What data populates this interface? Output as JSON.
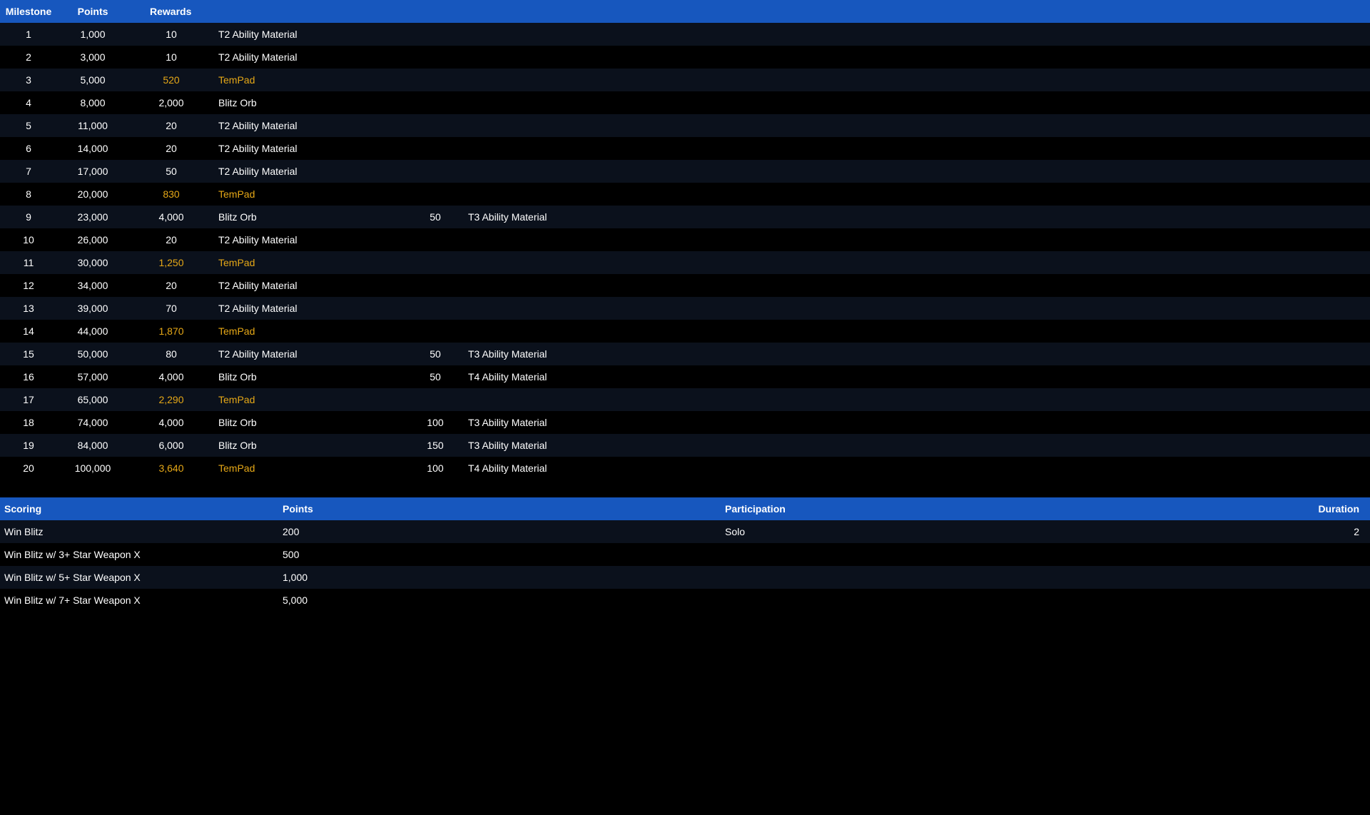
{
  "milestonesHeader": {
    "milestone": "Milestone",
    "points": "Points",
    "rewards": "Rewards"
  },
  "milestones": [
    {
      "milestone": "1",
      "points": "1,000",
      "r1q": "10",
      "r1item": "T2 Ability Material",
      "gold": false,
      "r2q": "",
      "r2item": ""
    },
    {
      "milestone": "2",
      "points": "3,000",
      "r1q": "10",
      "r1item": "T2 Ability Material",
      "gold": false,
      "r2q": "",
      "r2item": ""
    },
    {
      "milestone": "3",
      "points": "5,000",
      "r1q": "520",
      "r1item": "TemPad",
      "gold": true,
      "r2q": "",
      "r2item": ""
    },
    {
      "milestone": "4",
      "points": "8,000",
      "r1q": "2,000",
      "r1item": "Blitz Orb",
      "gold": false,
      "r2q": "",
      "r2item": ""
    },
    {
      "milestone": "5",
      "points": "11,000",
      "r1q": "20",
      "r1item": "T2 Ability Material",
      "gold": false,
      "r2q": "",
      "r2item": ""
    },
    {
      "milestone": "6",
      "points": "14,000",
      "r1q": "20",
      "r1item": "T2 Ability Material",
      "gold": false,
      "r2q": "",
      "r2item": ""
    },
    {
      "milestone": "7",
      "points": "17,000",
      "r1q": "50",
      "r1item": "T2 Ability Material",
      "gold": false,
      "r2q": "",
      "r2item": ""
    },
    {
      "milestone": "8",
      "points": "20,000",
      "r1q": "830",
      "r1item": "TemPad",
      "gold": true,
      "r2q": "",
      "r2item": ""
    },
    {
      "milestone": "9",
      "points": "23,000",
      "r1q": "4,000",
      "r1item": "Blitz Orb",
      "gold": false,
      "r2q": "50",
      "r2item": "T3 Ability Material"
    },
    {
      "milestone": "10",
      "points": "26,000",
      "r1q": "20",
      "r1item": "T2 Ability Material",
      "gold": false,
      "r2q": "",
      "r2item": ""
    },
    {
      "milestone": "11",
      "points": "30,000",
      "r1q": "1,250",
      "r1item": "TemPad",
      "gold": true,
      "r2q": "",
      "r2item": ""
    },
    {
      "milestone": "12",
      "points": "34,000",
      "r1q": "20",
      "r1item": "T2 Ability Material",
      "gold": false,
      "r2q": "",
      "r2item": ""
    },
    {
      "milestone": "13",
      "points": "39,000",
      "r1q": "70",
      "r1item": "T2 Ability Material",
      "gold": false,
      "r2q": "",
      "r2item": ""
    },
    {
      "milestone": "14",
      "points": "44,000",
      "r1q": "1,870",
      "r1item": "TemPad",
      "gold": true,
      "r2q": "",
      "r2item": ""
    },
    {
      "milestone": "15",
      "points": "50,000",
      "r1q": "80",
      "r1item": "T2 Ability Material",
      "gold": false,
      "r2q": "50",
      "r2item": "T3 Ability Material"
    },
    {
      "milestone": "16",
      "points": "57,000",
      "r1q": "4,000",
      "r1item": "Blitz Orb",
      "gold": false,
      "r2q": "50",
      "r2item": "T4 Ability Material"
    },
    {
      "milestone": "17",
      "points": "65,000",
      "r1q": "2,290",
      "r1item": "TemPad",
      "gold": true,
      "r2q": "",
      "r2item": ""
    },
    {
      "milestone": "18",
      "points": "74,000",
      "r1q": "4,000",
      "r1item": "Blitz Orb",
      "gold": false,
      "r2q": "100",
      "r2item": "T3 Ability Material"
    },
    {
      "milestone": "19",
      "points": "84,000",
      "r1q": "6,000",
      "r1item": "Blitz Orb",
      "gold": false,
      "r2q": "150",
      "r2item": "T3 Ability Material"
    },
    {
      "milestone": "20",
      "points": "100,000",
      "r1q": "3,640",
      "r1item": "TemPad",
      "gold": true,
      "r2q": "100",
      "r2item": "T4 Ability Material"
    }
  ],
  "scoringHeader": {
    "scoring": "Scoring",
    "points": "Points",
    "participation": "Participation",
    "duration": "Duration"
  },
  "scoring": [
    {
      "label": "Win Blitz",
      "points": "200",
      "participation": "Solo",
      "duration": "2"
    },
    {
      "label": "Win Blitz w/ 3+ Star Weapon X",
      "points": "500",
      "participation": "",
      "duration": ""
    },
    {
      "label": "Win Blitz w/ 5+ Star Weapon X",
      "points": "1,000",
      "participation": "",
      "duration": ""
    },
    {
      "label": "Win Blitz w/ 7+ Star Weapon X",
      "points": "5,000",
      "participation": "",
      "duration": ""
    }
  ]
}
